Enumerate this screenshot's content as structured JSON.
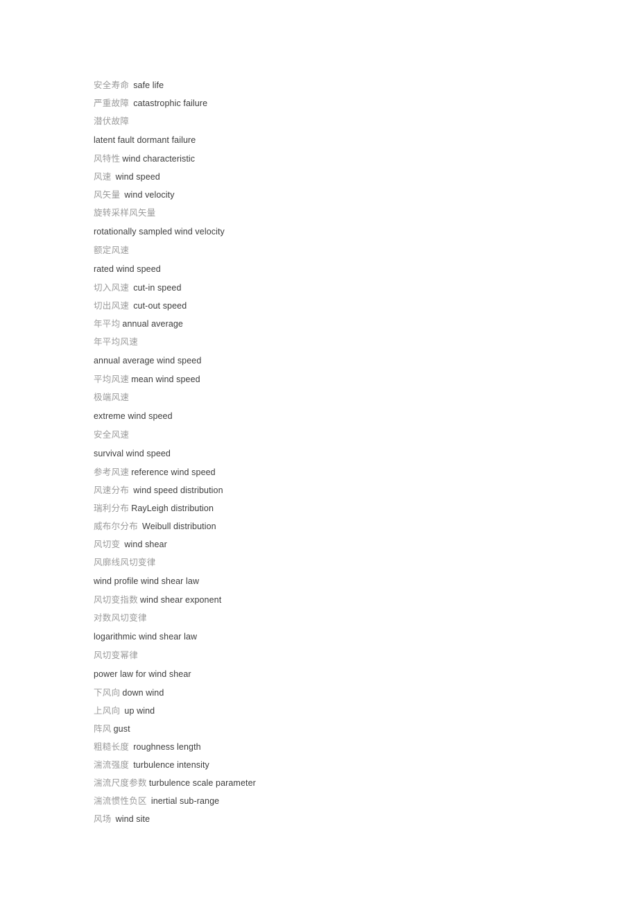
{
  "document": {
    "type": "bilingual-glossary",
    "background_color": "#ffffff",
    "chinese_text_color": "#9a9a9a",
    "english_text_color": "#3c3c3c",
    "entries": [
      {
        "zh": "安全寿命",
        "en": "safe life",
        "gap": "wide"
      },
      {
        "zh": "严重故障",
        "en": "catastrophic failure",
        "gap": "wide"
      },
      {
        "zh": "潜伏故障",
        "en": "",
        "gap": "none"
      },
      {
        "zh": "",
        "en": "latent fault dormant failure",
        "gap": "none"
      },
      {
        "zh": "风特性",
        "en": "wind characteristic",
        "gap": "narrow"
      },
      {
        "zh": "风速",
        "en": "wind speed",
        "gap": "wide"
      },
      {
        "zh": "风矢量",
        "en": "wind velocity",
        "gap": "wide"
      },
      {
        "zh": "旋转采样风矢量",
        "en": "",
        "gap": "none"
      },
      {
        "zh": "",
        "en": "rotationally sampled wind velocity",
        "gap": "none"
      },
      {
        "zh": "额定风速",
        "en": "",
        "gap": "none"
      },
      {
        "zh": "",
        "en": "rated wind speed",
        "gap": "none"
      },
      {
        "zh": "切入风速",
        "en": "cut-in speed",
        "gap": "wide"
      },
      {
        "zh": "切出风速",
        "en": "cut-out speed",
        "gap": "wide"
      },
      {
        "zh": "年平均",
        "en": "annual average",
        "gap": "narrow"
      },
      {
        "zh": "年平均风速",
        "en": "",
        "gap": "none"
      },
      {
        "zh": "",
        "en": "annual average wind speed",
        "gap": "none"
      },
      {
        "zh": "平均风速",
        "en": "mean wind speed",
        "gap": "narrow"
      },
      {
        "zh": "极端风速",
        "en": "",
        "gap": "none"
      },
      {
        "zh": "",
        "en": "extreme wind speed",
        "gap": "none"
      },
      {
        "zh": "安全风速",
        "en": "",
        "gap": "none"
      },
      {
        "zh": "",
        "en": "survival wind speed",
        "gap": "none"
      },
      {
        "zh": "参考风速",
        "en": "reference wind speed",
        "gap": "narrow"
      },
      {
        "zh": "风速分布",
        "en": "wind speed distribution",
        "gap": "wide"
      },
      {
        "zh": "瑞利分布",
        "en": "RayLeigh distribution",
        "gap": "narrow"
      },
      {
        "zh": "威布尔分布",
        "en": "Weibull distribution",
        "gap": "wide"
      },
      {
        "zh": "风切变",
        "en": "wind shear",
        "gap": "wide"
      },
      {
        "zh": "风廓线风切变律",
        "en": "",
        "gap": "none"
      },
      {
        "zh": "",
        "en": "wind profile wind shear law",
        "gap": "none"
      },
      {
        "zh": "风切变指数",
        "en": "wind shear exponent",
        "gap": "narrow"
      },
      {
        "zh": "对数风切变律",
        "en": "",
        "gap": "none"
      },
      {
        "zh": "",
        "en": "logarithmic wind shear law",
        "gap": "none"
      },
      {
        "zh": "风切变幂律",
        "en": "",
        "gap": "none"
      },
      {
        "zh": "",
        "en": "power law for wind shear",
        "gap": "none"
      },
      {
        "zh": "下风向",
        "en": "down wind",
        "gap": "narrow"
      },
      {
        "zh": "上风向",
        "en": "up wind",
        "gap": "wide"
      },
      {
        "zh": "阵风",
        "en": "gust",
        "gap": "narrow"
      },
      {
        "zh": "粗糙长度",
        "en": "roughness length",
        "gap": "wide"
      },
      {
        "zh": "湍流强度",
        "en": "turbulence intensity",
        "gap": "wide"
      },
      {
        "zh": "湍流尺度参数",
        "en": "turbulence scale parameter",
        "gap": "narrow"
      },
      {
        "zh": "湍流惯性负区",
        "en": "inertial sub-range",
        "gap": "wide"
      },
      {
        "zh": "风场",
        "en": "wind site",
        "gap": "wide"
      }
    ]
  }
}
